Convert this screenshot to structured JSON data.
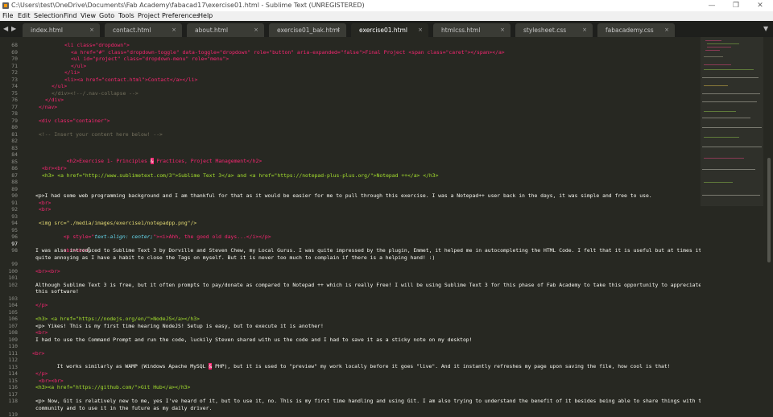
{
  "titlebar": {
    "title": "C:\\Users\\test\\OneDrive\\Documents\\Fab Academy\\fabacad17\\exercise01.html - Sublime Text (UNREGISTERED)",
    "minimize": "—",
    "maximize": "❐",
    "close": "✕"
  },
  "menu": [
    "File",
    "Edit",
    "Selection",
    "Find",
    "View",
    "Goto",
    "Tools",
    "Project",
    "Preferences",
    "Help"
  ],
  "tabs": [
    {
      "label": "index.html",
      "close": "×"
    },
    {
      "label": "contact.html",
      "close": "×"
    },
    {
      "label": "about.html",
      "close": "×"
    },
    {
      "label": "exercise01_bak.html",
      "close": "×"
    },
    {
      "label": "exercise01.html",
      "close": "×",
      "active": true
    },
    {
      "label": "htmlcss.html",
      "close": "×"
    },
    {
      "label": "stylesheet.css",
      "close": "×"
    },
    {
      "label": "fabacademy.css",
      "close": "×"
    }
  ],
  "tab_nav": {
    "left": "◀",
    "right": "▶",
    "overflow": "▼"
  },
  "gutter": [
    "68",
    "69",
    "70",
    "71",
    "72",
    "73",
    "74",
    "75",
    "76",
    "77",
    "78",
    "79",
    "80",
    "81",
    "82",
    "83",
    "84",
    "85",
    "86",
    "87",
    "88",
    "89",
    "90",
    "91",
    "92",
    "93",
    "94",
    "95",
    "96",
    "97",
    "98",
    "99",
    "100",
    "101",
    "102",
    "103",
    "104",
    "105",
    "106",
    "107",
    "108",
    "109",
    "110",
    "111",
    "112",
    "113",
    "114",
    "115",
    "116",
    "117",
    "118",
    "119"
  ],
  "code": {
    "l68": {
      "text": "<li class=\"dropdown\">"
    },
    "l69": {
      "text": "<a href=\"#\" class=\"dropdown-toggle\" data-toggle=\"dropdown\" role=\"button\" aria-expanded=\"false\">Final Project <span class=\"caret\"></span></a>"
    },
    "l70": {
      "text": "<ul id=\"project\" class=\"dropdown-menu\" role=\"menu\">"
    },
    "l71": {
      "text": "</ul>"
    },
    "l72": {
      "text": "</li>"
    },
    "l73": {
      "text": "<li><a href=\"contact.html\">Contact</a></li>"
    },
    "l74": {
      "text": "</ul>"
    },
    "l75": {
      "text": "</div><!--/.nav-collapse -->"
    },
    "l76": {
      "text": "</div>"
    },
    "l77": {
      "text": "</nav>"
    },
    "l79": {
      "text": "<div class=\"container\">"
    },
    "l81": {
      "text": "<!-- Insert your content here below! -->"
    },
    "l84a": {
      "text": "<h2>Exercise 1- Principles "
    },
    "l84amp": {
      "text": "&"
    },
    "l84b": {
      "text": " Practices, Project Management</h2>"
    },
    "l86": {
      "text": "<br><br>"
    },
    "l87": {
      "text": "<h3> <a href=\"http://www.sublimetext.com/3\">Sublime Text 3</a> and <a href=\"https://notepad-plus-plus.org/\">Notepad ++</a> </h3>"
    },
    "l90": {
      "text": "<p>I had some web programming background and I am thankful for that as it would be easier for me to pull through this exercise. I was a Notepad++ user back in the days, it was simple and free to use."
    },
    "l91": {
      "text": "<br>"
    },
    "l92": {
      "text": "<br>"
    },
    "l94": {
      "text": "<img src=\"./media/images/exercise1/notepadpp.png\"/>"
    },
    "l95a": {
      "text": "<p style=\""
    },
    "l95prop": {
      "text": "text-align: center;"
    },
    "l95b": {
      "text": "\"><i>Ahh, the good old days...</i></p>"
    },
    "l97": {
      "text": "<br><br>"
    },
    "l98a": {
      "text": "I was also introduced to Sublime Text 3 by Dorville and Steven Chew, my Local Gurus. I was quite impressed by the plugin, Emmet, it helped me in autocompleting the HTML Code. I felt that it is useful but at times it is"
    },
    "l98b": {
      "text": "quite annoying as I have a habit to close the Tags on myself. But it is never too much to complain if there is a helping hand! :)"
    },
    "l100": {
      "text": "<br><br>"
    },
    "l102a": {
      "text": "Although Sublime Text 3 is free, but it often prompts to pay/donate as compared to Notepad ++ which is really Free! I will be using Sublime Text 3 for this phase of Fab Academy to take this opportunity to appreciate"
    },
    "l102b": {
      "text": "this software!"
    },
    "l104": {
      "text": "</p>"
    },
    "l106": {
      "text": "<h3> <a href=\"https://nodejs.org/en/\">NodeJS</a></h3>"
    },
    "l107": {
      "text": "<p> Yikes! This is my first time hearing NodeJS! Setup is easy, but to execute it is another!"
    },
    "l108": {
      "text": "<br>"
    },
    "l109": {
      "text": "I had to use the Command Prompt and run the code, luckily Steven shared with us the code and I had to save it as a sticky note on my desktop!"
    },
    "l111": {
      "text": "<br>"
    },
    "l112a": {
      "text": "It works similarly as WAMP (Windows Apache MySQL "
    },
    "l112amp": {
      "text": "&"
    },
    "l112b": {
      "text": " PHP), but it is used to \"preview\" my work locally before it goes \"live\". And it instantly refreshes my page upon saving the file, how cool is that!"
    },
    "l114": {
      "text": "</p>"
    },
    "l115": {
      "text": "<br><br>"
    },
    "l116": {
      "text": "<h3><a href=\"https://github.com/\">Git Hub</a></h3>"
    },
    "l118a": {
      "text": "<p> Now, Git is relatively new to me, yes I've heard of it, but to use it, no. This is my first time handling and using Git. I am also trying to understand the benefit of it besides being able to share things with the"
    },
    "l118b": {
      "text": "community and to use it in the future as my daily driver."
    }
  },
  "colors": {
    "bg": "#272822",
    "tag": "#f92672",
    "attr": "#a6e22e",
    "string": "#e6db74",
    "comment": "#75715e",
    "text": "#f8f8f2"
  }
}
